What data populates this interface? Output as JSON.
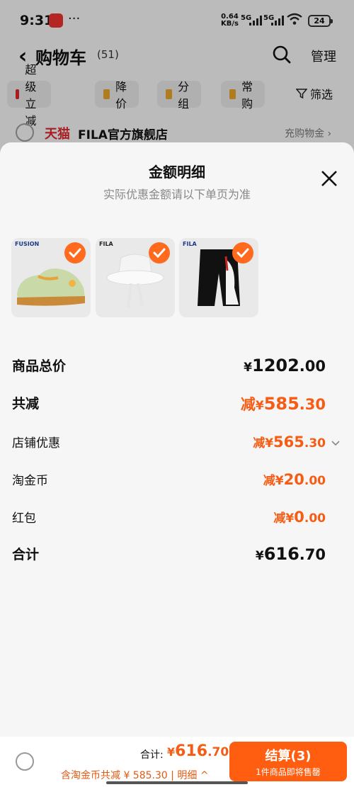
{
  "status_bar": {
    "time": "9:31",
    "dots": "···",
    "net_speed": "0.64",
    "net_speed_unit": "KB/s",
    "network_1": "5G",
    "network_2": "5G",
    "battery": "24"
  },
  "nav": {
    "title": "购物车",
    "count": "(51)",
    "manage": "管理"
  },
  "filters": [
    {
      "label": "超级立减",
      "icon_color": "#d9262c"
    },
    {
      "label": "降价",
      "icon_color": "#e0a12a"
    },
    {
      "label": "分组",
      "icon_color": "#e0a12a"
    },
    {
      "label": "常购",
      "icon_color": "#e0a12a"
    }
  ],
  "filter_label": "筛选",
  "store": {
    "platform": "天猫",
    "name": "FILA官方旗舰店",
    "promo": "充购物金 ›"
  },
  "sheet": {
    "title": "金额明细",
    "subtitle": "实际优惠金额请以下单页为准",
    "items": [
      {
        "brand": "FUSION",
        "kind": "sneaker"
      },
      {
        "brand": "FILA",
        "kind": "bucket-hat"
      },
      {
        "brand": "FILA",
        "kind": "shorts"
      }
    ],
    "rows": {
      "subtotal": {
        "label": "商品总价",
        "currency": "¥",
        "int": "1202",
        "dec": ".00"
      },
      "total_discount": {
        "label": "共减",
        "prefix": "减",
        "currency": "¥",
        "int": "585",
        "dec": ".30"
      },
      "store_discount": {
        "label": "店铺优惠",
        "prefix": "减",
        "currency": "¥",
        "int": "565",
        "dec": ".30"
      },
      "taojinbi": {
        "label": "淘金币",
        "prefix": "减",
        "currency": "¥",
        "int": "20",
        "dec": ".00"
      },
      "hongbao": {
        "label": "红包",
        "prefix": "减",
        "currency": "¥",
        "int": "0",
        "dec": ".00"
      },
      "total": {
        "label": "合计",
        "currency": "¥",
        "int": "616",
        "dec": ".70"
      }
    }
  },
  "bottom_bar": {
    "total_label": "合计:",
    "currency": "¥",
    "total_int": "616",
    "total_dec": ".70",
    "breakdown": "含淘金币共减 ¥ 585.30 | 明细 ^",
    "checkout_label": "结算(3)",
    "checkout_sub": "1件商品即将售罄"
  },
  "colors": {
    "accent": "#ff5d10",
    "discount": "#f65c13",
    "tmall": "#d9262c"
  }
}
